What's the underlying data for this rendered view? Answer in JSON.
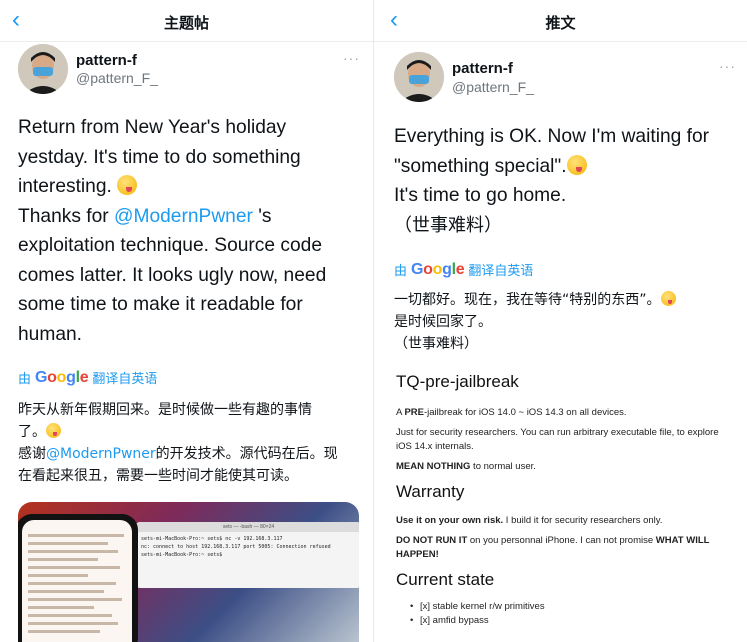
{
  "left": {
    "nav_title": "主题帖",
    "author": {
      "name": "pattern-f",
      "handle": "@pattern_F_"
    },
    "tweet": {
      "line1": "Return from New Year's holiday",
      "line2": "yestday. It's time to do something",
      "line3": "interesting.",
      "line4_pre": "Thanks for ",
      "mention": "@ModernPwner",
      "line4_post": " 's",
      "line5": "exploitation technique. Source code",
      "line6": "comes latter. It looks ugly now, need",
      "line7": "some time to make it readable for",
      "line8": "human."
    },
    "translate": {
      "prefix": "由",
      "suffix": "翻译自英语"
    },
    "translated": {
      "line1": "昨天从新年假期回来。是时候做一些有趣的事情",
      "line2": "了。",
      "line3_pre": "感谢",
      "mention": "@ModernPwner",
      "line3_post": "的开发技术。源代码在后。现",
      "line4": "在看起来很丑，需要一些时间才能使其可读。"
    },
    "terminal": {
      "title": "sets — -bash — 80×24",
      "lines": [
        "sets-mi-MacBook-Pro:~ sets$ nc -v 192.168.3.117",
        "nc: connect to host 192.168.3.117 port 5005: Connection refused",
        "sets-mi-MacBook-Pro:~ sets$"
      ]
    }
  },
  "right": {
    "nav_title": "推文",
    "author": {
      "name": "pattern-f",
      "handle": "@pattern_F_"
    },
    "tweet": {
      "line1": "Everything is OK. Now I'm waiting for",
      "line2": "\"something special\".",
      "line3": "It's time to go home.",
      "line4": "（世事难料）"
    },
    "translate": {
      "prefix": "由",
      "suffix": "翻译自英语"
    },
    "translated": {
      "line1": "一切都好。现在，我在等待“特别的东西”。",
      "line2": "是时候回家了。",
      "line3": "（世事难料）"
    },
    "card": {
      "title": "TQ-pre-jailbreak",
      "p1_pre": "A ",
      "p1_bold": "PRE",
      "p1_post": "-jailbreak for iOS 14.0 ~ iOS 14.3 on all devices.",
      "p2": "Just for security researchers. You can run arbitrary executable file, to explore iOS 14.x internals.",
      "p3_bold": "MEAN NOTHING",
      "p3_post": " to normal user.",
      "h_warranty": "Warranty",
      "w1_bold": "Use it on your own risk.",
      "w1_post": " I build it for security researchers only.",
      "w2_bold": "DO NOT RUN IT",
      "w2_mid": " on you personnal iPhone. I can not promise ",
      "w2_bold2": "WHAT WILL HAPPEN!",
      "h_state": "Current state",
      "items": [
        "[x] stable kernel r/w primitives",
        "[x] amfid bypass"
      ]
    }
  },
  "ui": {
    "more_glyph": "···",
    "back_glyph": "‹"
  }
}
